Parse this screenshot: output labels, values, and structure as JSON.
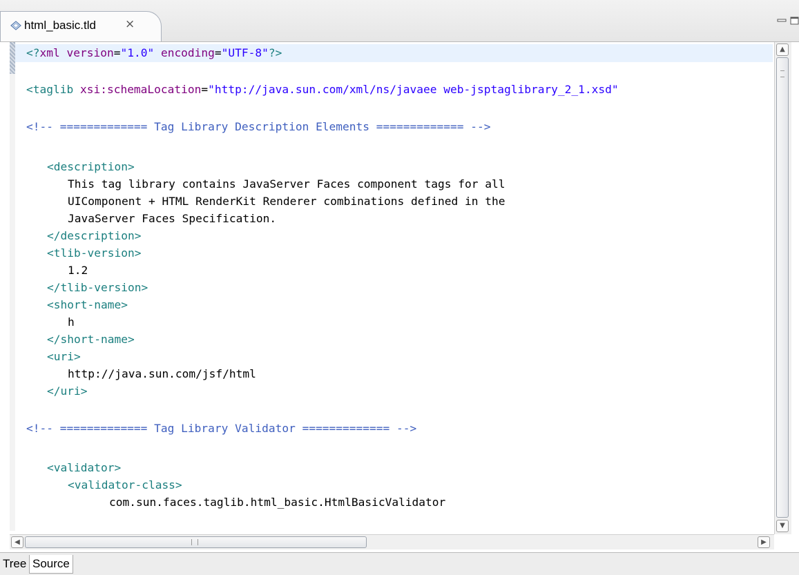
{
  "editor_tab": {
    "title": "html_basic.tld",
    "close_glyph": "⨯",
    "icon": "xml-file-icon"
  },
  "window_controls": {
    "minimize_icon": "minimize-icon",
    "maximize_icon": "maximize-icon"
  },
  "code": {
    "l1": {
      "a": "<?",
      "b": "xml ",
      "c": "version",
      "d": "=",
      "e": "\"1.0\"",
      "f": " encoding",
      "g": "=",
      "h": "\"UTF-8\"",
      "i": "?>"
    },
    "l2": {
      "a": "<taglib ",
      "b": "xsi:schemaLocation",
      "c": "=",
      "d": "\"http://java.sun.com/xml/ns/javaee web-jsptaglibrary_2_1.xsd\""
    },
    "l3": "<!-- ============= Tag Library Description Elements ============= -->",
    "l4": "<description>",
    "l5": "This tag library contains JavaServer Faces component tags for all",
    "l6": "UIComponent + HTML RenderKit Renderer combinations defined in the",
    "l7": "JavaServer Faces Specification.",
    "l8": "</description>",
    "l9": "<tlib-version>",
    "l10": "1.2",
    "l11": "</tlib-version>",
    "l12": "<short-name>",
    "l13": "h",
    "l14": "</short-name>",
    "l15": "<uri>",
    "l16": "http://java.sun.com/jsf/html",
    "l17": "</uri>",
    "l18": "<!-- ============= Tag Library Validator ============= -->",
    "l19": "<validator>",
    "l20": "<validator-class>",
    "l21": "com.sun.faces.taglib.html_basic.HtmlBasicValidator"
  },
  "scrollbars": {
    "up": "▲",
    "down": "▼",
    "left": "◀",
    "right": "▶"
  },
  "bottom_tabs": {
    "tree": "Tree",
    "source": "Source"
  }
}
